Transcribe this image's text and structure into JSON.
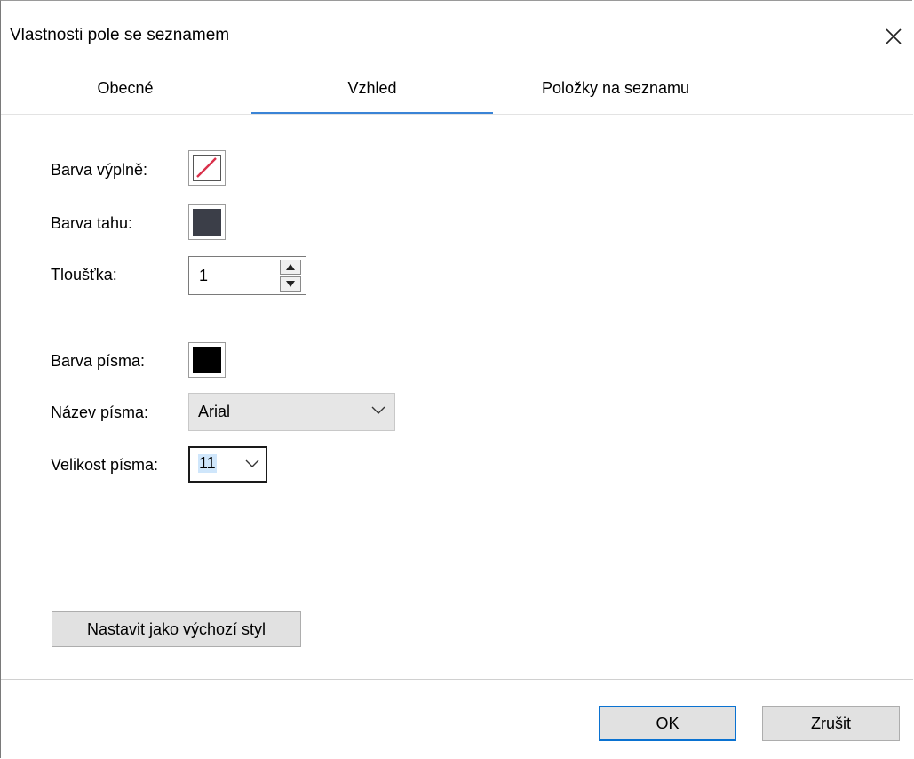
{
  "dialog": {
    "title": "Vlastnosti pole se seznamem",
    "close_icon": "close-icon"
  },
  "tabs": [
    {
      "label": "Obecné",
      "active": false
    },
    {
      "label": "Vzhled",
      "active": true
    },
    {
      "label": "Položky na seznamu",
      "active": false
    }
  ],
  "appearance": {
    "fill_color_label": "Barva výplně:",
    "fill_color_value": "none",
    "stroke_color_label": "Barva tahu:",
    "stroke_color_value": "#3b3e48",
    "thickness_label": "Tloušťka:",
    "thickness_value": "1",
    "font_color_label": "Barva písma:",
    "font_color_value": "#000000",
    "font_name_label": "Název písma:",
    "font_name_value": "Arial",
    "font_size_label": "Velikost písma:",
    "font_size_value": "11"
  },
  "buttons": {
    "set_default_style": "Nastavit jako výchozí styl",
    "ok": "OK",
    "cancel": "Zrušit"
  },
  "colors": {
    "accent": "#3a84d6",
    "no_fill_slash": "#d9304a"
  }
}
